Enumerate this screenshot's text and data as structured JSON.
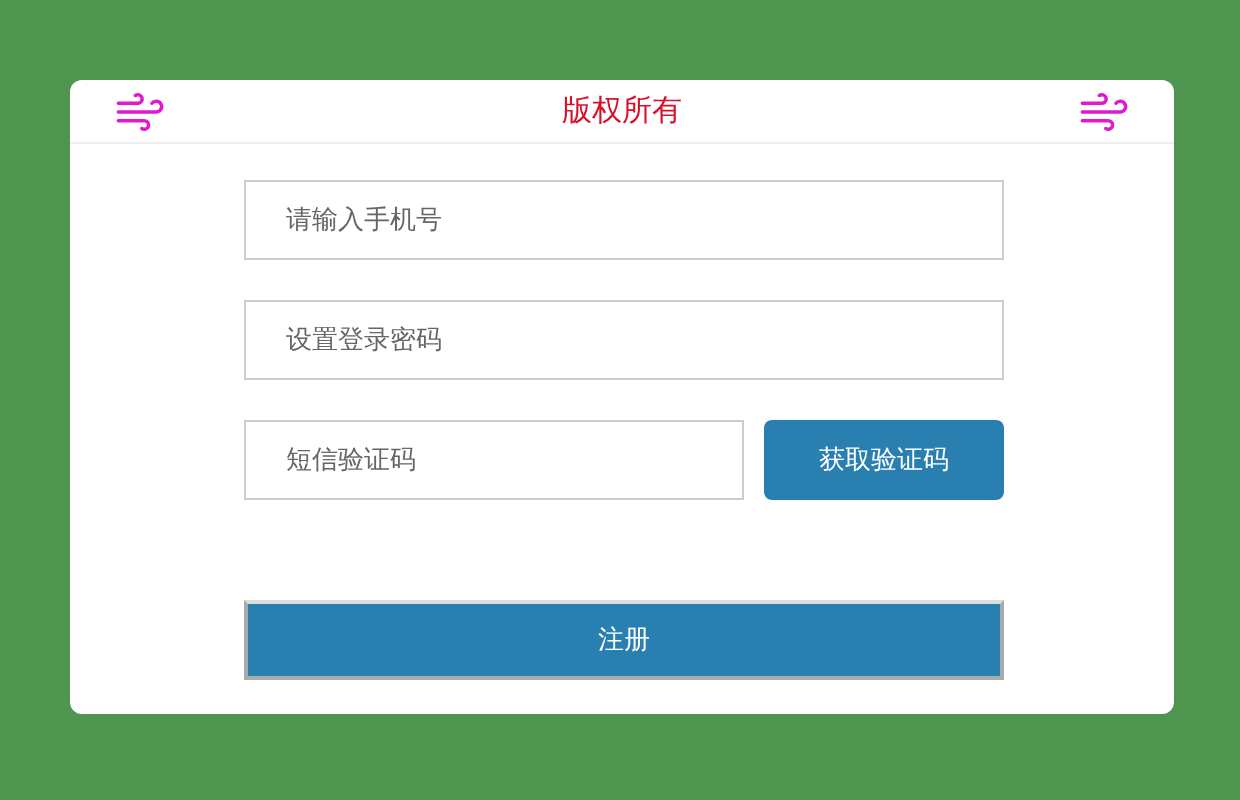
{
  "header": {
    "title": "版权所有"
  },
  "fields": [
    {
      "placeholder": "请输入手机号"
    },
    {
      "placeholder": "设置登录密码"
    }
  ],
  "code_field": {
    "placeholder": "短信验证码"
  },
  "code_button": "获取验证码",
  "submit_button": "注册"
}
